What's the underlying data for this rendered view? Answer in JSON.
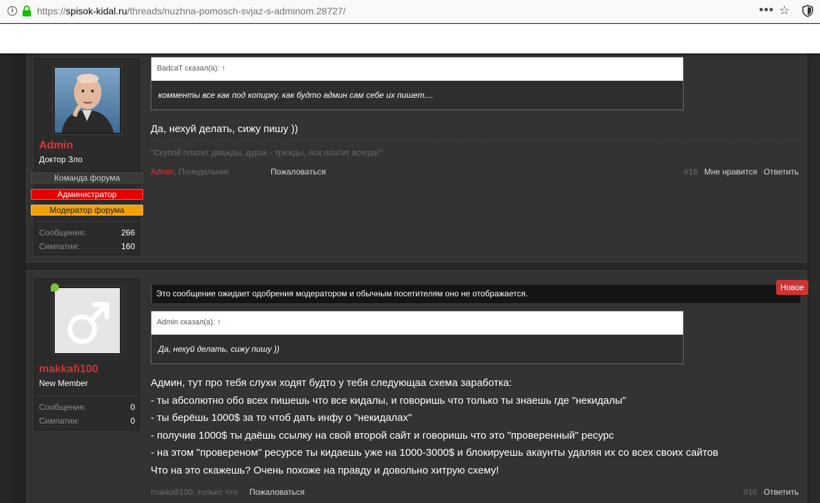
{
  "browser": {
    "url_protocol": "https://",
    "url_host": "spisok-kidal.ru",
    "url_path": "/threads/nuzhna-pomosch-svjaz-s-adminom.28727/",
    "more_glyph": "•••",
    "star_glyph": "☆",
    "info_glyph": "i"
  },
  "posts": [
    {
      "user": {
        "name": "Admin",
        "name_color": "#e53333",
        "title": "Доктор Зло",
        "badges": [
          "Команда форума",
          "Администратор",
          "Модератор форума"
        ],
        "stats": [
          {
            "label": "Сообщения:",
            "value": "266"
          },
          {
            "label": "Симпатии:",
            "value": "160"
          }
        ]
      },
      "quote": {
        "author_line": "BadcaT сказал(а):",
        "arrow": "↑",
        "text": "комменты все как под копирку. как будто админ сам себе их пишет...."
      },
      "message": [
        "Да, нехуй делать, сижу пишу ))"
      ],
      "signature": "\"Скупой платит дважды, дурак - трижды, лох платит всегда!\"",
      "meta": {
        "author": "Admin",
        "date": ", Понедельник"
      },
      "report": "Пожаловаться",
      "number": "#16",
      "actions": [
        "Мне нравится",
        "Ответить"
      ]
    },
    {
      "user": {
        "name": "makkafi100",
        "name_color": "#cc3333",
        "title": "New Member",
        "stats": [
          {
            "label": "Сообщения:",
            "value": "0"
          },
          {
            "label": "Симпатии:",
            "value": "0"
          }
        ]
      },
      "pending_notice": "Это сообщение ожидает одобрения модератором и обычным посетителям оно не отображается.",
      "new_tag": "Новое",
      "quote": {
        "author_line": "Admin сказал(а):",
        "arrow": "↑",
        "text": "Да, нехуй делать, сижу пишу ))"
      },
      "message": [
        "Админ, тут про тебя слухи ходят будто у тебя следующаа схема заработка:",
        "- ты абсолютно обо всех пишешь что все кидалы, и говоришь что только ты знаешь где \"некидалы\"",
        "- ты берёшь 1000$ за то чтоб дать инфу о \"некидалах\"",
        "- получив 1000$ ты даёшь ссылку на свой второй сайт и говоришь что это \"проверенный\" ресурс",
        "- на этом \"провереном\" ресурсе ты кидаешь уже на 1000-3000$ и блокируешь акаунты удаляя их со всех своих сайтов",
        "Что на это скажешь? Очень похоже на правду и довольно хитрую схему!"
      ],
      "meta": {
        "author": "makkafi100",
        "date": ", только что"
      },
      "report": "Пожаловаться",
      "number": "#16",
      "actions": [
        "Ответить"
      ]
    }
  ]
}
